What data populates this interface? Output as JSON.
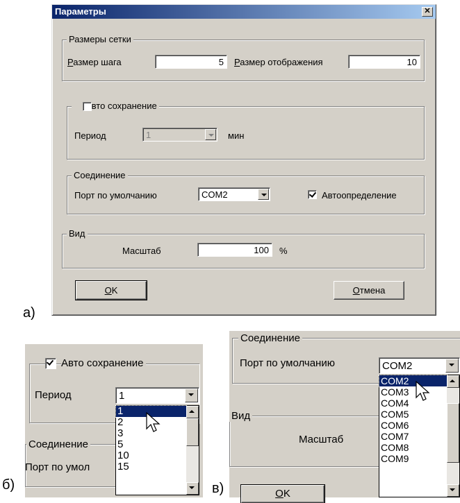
{
  "captions": {
    "a": "а)",
    "b": "б)",
    "v": "в)"
  },
  "dialog": {
    "title": "Параметры",
    "close_glyph": "✕",
    "grid": {
      "legend": "Размеры сетки",
      "step_label_accel": "Р",
      "step_label_rest": "азмер шага",
      "step_value": "5",
      "display_label_accel": "Р",
      "display_label_rest": "азмер отображения",
      "display_value": "10"
    },
    "autosave": {
      "legend": "Авто сохранение",
      "checked": false,
      "period_label": "Период",
      "period_value": "1",
      "unit": "мин"
    },
    "connection": {
      "legend": "Соединение",
      "port_label": "Порт по умолчанию",
      "port_value": "COM2",
      "autodetect_label": "Автоопределение",
      "autodetect_checked": true
    },
    "view": {
      "legend": "Вид",
      "scale_label": "Масштаб",
      "scale_value": "100",
      "scale_unit": "%"
    },
    "ok_accel": "O",
    "ok_rest": "K",
    "cancel_accel": "О",
    "cancel_rest": "тмена"
  },
  "panel_b": {
    "autosave_label": "Авто сохранение",
    "autosave_checked": true,
    "period_label": "Период",
    "period_value": "1",
    "connection_legend": "Соединение",
    "port_label_partial": "Порт по умол",
    "period_options": [
      "1",
      "2",
      "3",
      "5",
      "10",
      "15"
    ],
    "selected_option": "1"
  },
  "panel_v": {
    "connection_legend": "Соединение",
    "port_label": "Порт по умолчанию",
    "port_value": "COM2",
    "view_legend": "Вид",
    "scale_label": "Масштаб",
    "ok_accel": "O",
    "ok_rest": "K",
    "port_options": [
      "COM2",
      "COM3",
      "COM4",
      "COM5",
      "COM6",
      "COM7",
      "COM8",
      "COM9"
    ],
    "selected_option": "COM2"
  }
}
